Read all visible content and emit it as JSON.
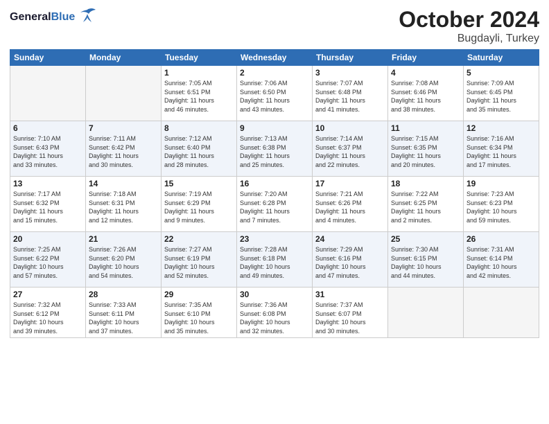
{
  "header": {
    "logo_general": "General",
    "logo_blue": "Blue",
    "month_title": "October 2024",
    "location": "Bugdayli, Turkey"
  },
  "weekdays": [
    "Sunday",
    "Monday",
    "Tuesday",
    "Wednesday",
    "Thursday",
    "Friday",
    "Saturday"
  ],
  "weeks": [
    [
      {
        "day": "",
        "empty": true
      },
      {
        "day": "",
        "empty": true
      },
      {
        "day": "1",
        "line1": "Sunrise: 7:05 AM",
        "line2": "Sunset: 6:51 PM",
        "line3": "Daylight: 11 hours",
        "line4": "and 46 minutes."
      },
      {
        "day": "2",
        "line1": "Sunrise: 7:06 AM",
        "line2": "Sunset: 6:50 PM",
        "line3": "Daylight: 11 hours",
        "line4": "and 43 minutes."
      },
      {
        "day": "3",
        "line1": "Sunrise: 7:07 AM",
        "line2": "Sunset: 6:48 PM",
        "line3": "Daylight: 11 hours",
        "line4": "and 41 minutes."
      },
      {
        "day": "4",
        "line1": "Sunrise: 7:08 AM",
        "line2": "Sunset: 6:46 PM",
        "line3": "Daylight: 11 hours",
        "line4": "and 38 minutes."
      },
      {
        "day": "5",
        "line1": "Sunrise: 7:09 AM",
        "line2": "Sunset: 6:45 PM",
        "line3": "Daylight: 11 hours",
        "line4": "and 35 minutes."
      }
    ],
    [
      {
        "day": "6",
        "line1": "Sunrise: 7:10 AM",
        "line2": "Sunset: 6:43 PM",
        "line3": "Daylight: 11 hours",
        "line4": "and 33 minutes."
      },
      {
        "day": "7",
        "line1": "Sunrise: 7:11 AM",
        "line2": "Sunset: 6:42 PM",
        "line3": "Daylight: 11 hours",
        "line4": "and 30 minutes."
      },
      {
        "day": "8",
        "line1": "Sunrise: 7:12 AM",
        "line2": "Sunset: 6:40 PM",
        "line3": "Daylight: 11 hours",
        "line4": "and 28 minutes."
      },
      {
        "day": "9",
        "line1": "Sunrise: 7:13 AM",
        "line2": "Sunset: 6:38 PM",
        "line3": "Daylight: 11 hours",
        "line4": "and 25 minutes."
      },
      {
        "day": "10",
        "line1": "Sunrise: 7:14 AM",
        "line2": "Sunset: 6:37 PM",
        "line3": "Daylight: 11 hours",
        "line4": "and 22 minutes."
      },
      {
        "day": "11",
        "line1": "Sunrise: 7:15 AM",
        "line2": "Sunset: 6:35 PM",
        "line3": "Daylight: 11 hours",
        "line4": "and 20 minutes."
      },
      {
        "day": "12",
        "line1": "Sunrise: 7:16 AM",
        "line2": "Sunset: 6:34 PM",
        "line3": "Daylight: 11 hours",
        "line4": "and 17 minutes."
      }
    ],
    [
      {
        "day": "13",
        "line1": "Sunrise: 7:17 AM",
        "line2": "Sunset: 6:32 PM",
        "line3": "Daylight: 11 hours",
        "line4": "and 15 minutes."
      },
      {
        "day": "14",
        "line1": "Sunrise: 7:18 AM",
        "line2": "Sunset: 6:31 PM",
        "line3": "Daylight: 11 hours",
        "line4": "and 12 minutes."
      },
      {
        "day": "15",
        "line1": "Sunrise: 7:19 AM",
        "line2": "Sunset: 6:29 PM",
        "line3": "Daylight: 11 hours",
        "line4": "and 9 minutes."
      },
      {
        "day": "16",
        "line1": "Sunrise: 7:20 AM",
        "line2": "Sunset: 6:28 PM",
        "line3": "Daylight: 11 hours",
        "line4": "and 7 minutes."
      },
      {
        "day": "17",
        "line1": "Sunrise: 7:21 AM",
        "line2": "Sunset: 6:26 PM",
        "line3": "Daylight: 11 hours",
        "line4": "and 4 minutes."
      },
      {
        "day": "18",
        "line1": "Sunrise: 7:22 AM",
        "line2": "Sunset: 6:25 PM",
        "line3": "Daylight: 11 hours",
        "line4": "and 2 minutes."
      },
      {
        "day": "19",
        "line1": "Sunrise: 7:23 AM",
        "line2": "Sunset: 6:23 PM",
        "line3": "Daylight: 10 hours",
        "line4": "and 59 minutes."
      }
    ],
    [
      {
        "day": "20",
        "line1": "Sunrise: 7:25 AM",
        "line2": "Sunset: 6:22 PM",
        "line3": "Daylight: 10 hours",
        "line4": "and 57 minutes."
      },
      {
        "day": "21",
        "line1": "Sunrise: 7:26 AM",
        "line2": "Sunset: 6:20 PM",
        "line3": "Daylight: 10 hours",
        "line4": "and 54 minutes."
      },
      {
        "day": "22",
        "line1": "Sunrise: 7:27 AM",
        "line2": "Sunset: 6:19 PM",
        "line3": "Daylight: 10 hours",
        "line4": "and 52 minutes."
      },
      {
        "day": "23",
        "line1": "Sunrise: 7:28 AM",
        "line2": "Sunset: 6:18 PM",
        "line3": "Daylight: 10 hours",
        "line4": "and 49 minutes."
      },
      {
        "day": "24",
        "line1": "Sunrise: 7:29 AM",
        "line2": "Sunset: 6:16 PM",
        "line3": "Daylight: 10 hours",
        "line4": "and 47 minutes."
      },
      {
        "day": "25",
        "line1": "Sunrise: 7:30 AM",
        "line2": "Sunset: 6:15 PM",
        "line3": "Daylight: 10 hours",
        "line4": "and 44 minutes."
      },
      {
        "day": "26",
        "line1": "Sunrise: 7:31 AM",
        "line2": "Sunset: 6:14 PM",
        "line3": "Daylight: 10 hours",
        "line4": "and 42 minutes."
      }
    ],
    [
      {
        "day": "27",
        "line1": "Sunrise: 7:32 AM",
        "line2": "Sunset: 6:12 PM",
        "line3": "Daylight: 10 hours",
        "line4": "and 39 minutes."
      },
      {
        "day": "28",
        "line1": "Sunrise: 7:33 AM",
        "line2": "Sunset: 6:11 PM",
        "line3": "Daylight: 10 hours",
        "line4": "and 37 minutes."
      },
      {
        "day": "29",
        "line1": "Sunrise: 7:35 AM",
        "line2": "Sunset: 6:10 PM",
        "line3": "Daylight: 10 hours",
        "line4": "and 35 minutes."
      },
      {
        "day": "30",
        "line1": "Sunrise: 7:36 AM",
        "line2": "Sunset: 6:08 PM",
        "line3": "Daylight: 10 hours",
        "line4": "and 32 minutes."
      },
      {
        "day": "31",
        "line1": "Sunrise: 7:37 AM",
        "line2": "Sunset: 6:07 PM",
        "line3": "Daylight: 10 hours",
        "line4": "and 30 minutes."
      },
      {
        "day": "",
        "empty": true
      },
      {
        "day": "",
        "empty": true
      }
    ]
  ]
}
